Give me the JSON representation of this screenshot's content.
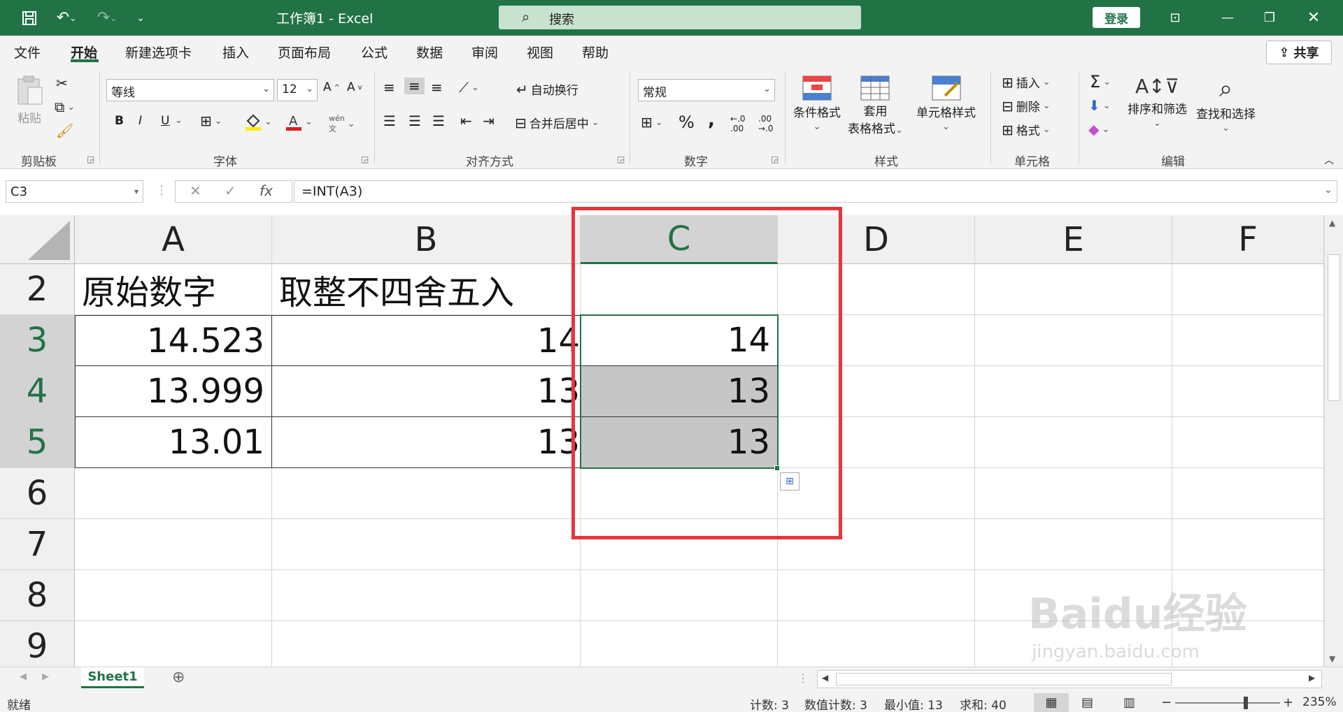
{
  "window": {
    "title": "工作簿1 - Excel",
    "search_placeholder": "搜索",
    "login": "登录"
  },
  "tabs": [
    "文件",
    "开始",
    "新建选项卡",
    "插入",
    "页面布局",
    "公式",
    "数据",
    "审阅",
    "视图",
    "帮助"
  ],
  "active_tab": "开始",
  "share": "共享",
  "ribbon": {
    "clipboard": {
      "label": "剪贴板",
      "paste": "粘贴"
    },
    "font": {
      "label": "字体",
      "name": "等线",
      "size": "12",
      "bold": "B",
      "italic": "I",
      "underline": "U"
    },
    "alignment": {
      "label": "对齐方式",
      "wrap": "自动换行",
      "merge": "合并后居中"
    },
    "number": {
      "label": "数字",
      "format": "常规",
      "percent": "%",
      "comma": ","
    },
    "styles": {
      "label": "样式",
      "conditional": "条件格式",
      "table1": "套用",
      "table2": "表格格式",
      "cell": "单元格样式"
    },
    "cells": {
      "label": "单元格",
      "insert": "插入",
      "delete": "删除",
      "format": "格式"
    },
    "editing": {
      "label": "编辑",
      "sort": "排序和筛选",
      "find": "查找和选择"
    }
  },
  "formula_bar": {
    "name_box": "C3",
    "formula": "=INT(A3)",
    "fx": "fx"
  },
  "columns": [
    "A",
    "B",
    "C",
    "D",
    "E",
    "F"
  ],
  "rows": [
    "2",
    "3",
    "4",
    "5",
    "6",
    "7",
    "8",
    "9"
  ],
  "cells": {
    "A2": "原始数字",
    "B2": "取整不四舍五入",
    "A3": "14.523",
    "B3": "14",
    "C3": "14",
    "A4": "13.999",
    "B4": "13",
    "C4": "13",
    "A5": "13.01",
    "B5": "13",
    "C5": "13"
  },
  "sheet_tab": "Sheet1",
  "status": {
    "ready": "就绪",
    "count": "计数: 3",
    "numcount": "数值计数: 3",
    "min": "最小值: 13",
    "sum": "求和: 40",
    "zoom": "235%"
  },
  "colors": {
    "brand": "#217346",
    "highlight_box": "#e8353a"
  },
  "watermark": {
    "text": "Baidu经验",
    "url": "jingyan.baidu.com"
  }
}
